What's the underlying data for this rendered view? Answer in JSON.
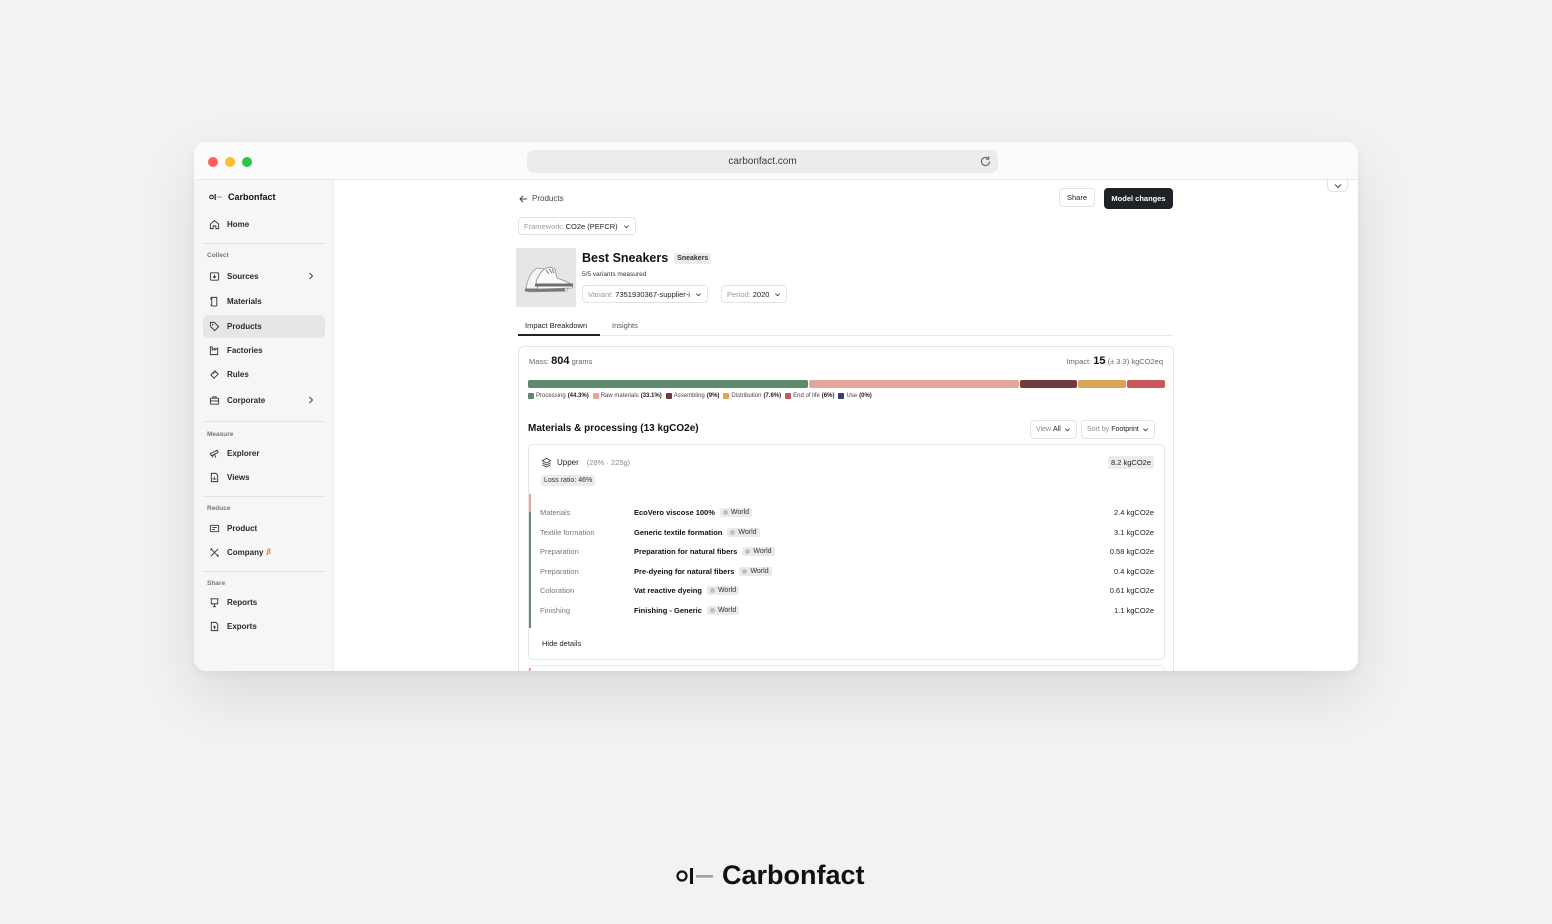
{
  "browser": {
    "url": "carbonfact.com",
    "lights": {
      "close": "#ff5f57",
      "minimize": "#febc2e",
      "maximize": "#28c840"
    }
  },
  "sidebar": {
    "brand": "Carbonfact",
    "home": "Home",
    "sections": {
      "collect": "Collect",
      "measure": "Measure",
      "reduce": "Reduce",
      "share": "Share"
    },
    "items": {
      "sources": "Sources",
      "materials": "Materials",
      "products": "Products",
      "factories": "Factories",
      "rules": "Rules",
      "corporate": "Corporate",
      "explorer": "Explorer",
      "views": "Views",
      "product": "Product",
      "company": "Company",
      "company_badge": "β",
      "reports": "Reports",
      "exports": "Exports"
    }
  },
  "header": {
    "back_label": "Products",
    "share_label": "Share",
    "model_changes_label": "Model changes"
  },
  "framework": {
    "label": "Framework:",
    "value": "CO2e (PEFCR)"
  },
  "product": {
    "title": "Best Sneakers",
    "category_tag": "Sneakers",
    "variants_measured": "5/5 variants measured",
    "variant_label": "Variant:",
    "variant_value": "7351930367-supplier-i",
    "period_label": "Period:",
    "period_value": "2020"
  },
  "tabs": [
    "Impact Breakdown",
    "Insights"
  ],
  "summary": {
    "mass_label": "Mass:",
    "mass_value": "804",
    "mass_unit": "grams",
    "impact_label": "Impact:",
    "impact_value": "15",
    "impact_unit": "(± 3.3) kgCO2eq"
  },
  "breakdown": [
    {
      "name": "Processing",
      "pct": "(44.3%)",
      "share": 44.3,
      "color": "#5e8a6e"
    },
    {
      "name": "Raw materials",
      "pct": "(33.1%)",
      "share": 33.1,
      "color": "#e3a699"
    },
    {
      "name": "Assembling",
      "pct": "(9%)",
      "share": 9,
      "color": "#6e3b3e"
    },
    {
      "name": "Distribution",
      "pct": "(7.6%)",
      "share": 7.6,
      "color": "#dba556"
    },
    {
      "name": "End of life",
      "pct": "(6%)",
      "share": 6,
      "color": "#c9575a"
    },
    {
      "name": "Use",
      "pct": "(0%)",
      "share": 0,
      "color": "#3b3f6b"
    }
  ],
  "materials_section": {
    "title": "Materials & processing",
    "total": "(13 kgCO2e)",
    "view_label": "View",
    "view_value": "All",
    "sort_label": "Sort by",
    "sort_value": "Footprint"
  },
  "component": {
    "name": "Upper",
    "meta": "(28% · 225g)",
    "value": "8.2 kgCO2e",
    "loss_ratio": "Loss ratio: 46%",
    "hide_details": "Hide details",
    "rows": [
      {
        "stage": "Materials",
        "material": "EcoVero viscose 100%",
        "region": "World",
        "value": "2.4 kgCO2e"
      },
      {
        "stage": "Textile formation",
        "material": "Generic textile formation",
        "region": "World",
        "value": "3.1 kgCO2e"
      },
      {
        "stage": "Preparation",
        "material": "Preparation for natural fibers",
        "region": "World",
        "value": "0.58 kgCO2e"
      },
      {
        "stage": "Preparation",
        "material": "Pre-dyeing for natural fibers",
        "region": "World",
        "value": "0.4 kgCO2e"
      },
      {
        "stage": "Coloration",
        "material": "Vat reactive dyeing",
        "region": "World",
        "value": "0.61 kgCO2e"
      },
      {
        "stage": "Finishing",
        "material": "Finishing - Generic",
        "region": "World",
        "value": "1.1 kgCO2e"
      }
    ]
  },
  "footer": {
    "brand": "Carbonfact"
  }
}
